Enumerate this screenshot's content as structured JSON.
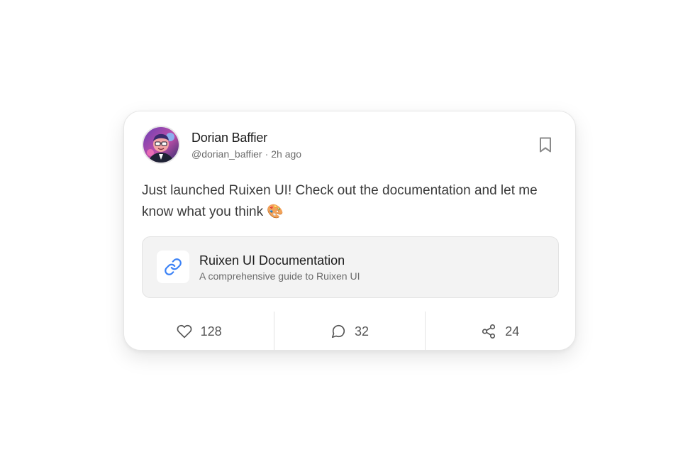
{
  "author": {
    "name": "Dorian Baffier",
    "handle": "@dorian_baffier",
    "separator": "·",
    "time_ago": "2h ago",
    "avatar_icon": "avatar-illustration"
  },
  "bookmark": {
    "icon": "bookmark-icon"
  },
  "post": {
    "text": "Just launched Ruixen UI! Check out the documentation and let me know what you think 🎨"
  },
  "link_preview": {
    "icon": "link-icon",
    "title": "Ruixen UI Documentation",
    "description": "A comprehensive guide to Ruixen UI",
    "accent_color": "#3b82f6"
  },
  "actions": {
    "likes": {
      "icon": "heart-icon",
      "count": "128"
    },
    "comments": {
      "icon": "comment-icon",
      "count": "32"
    },
    "shares": {
      "icon": "share-icon",
      "count": "24"
    }
  }
}
